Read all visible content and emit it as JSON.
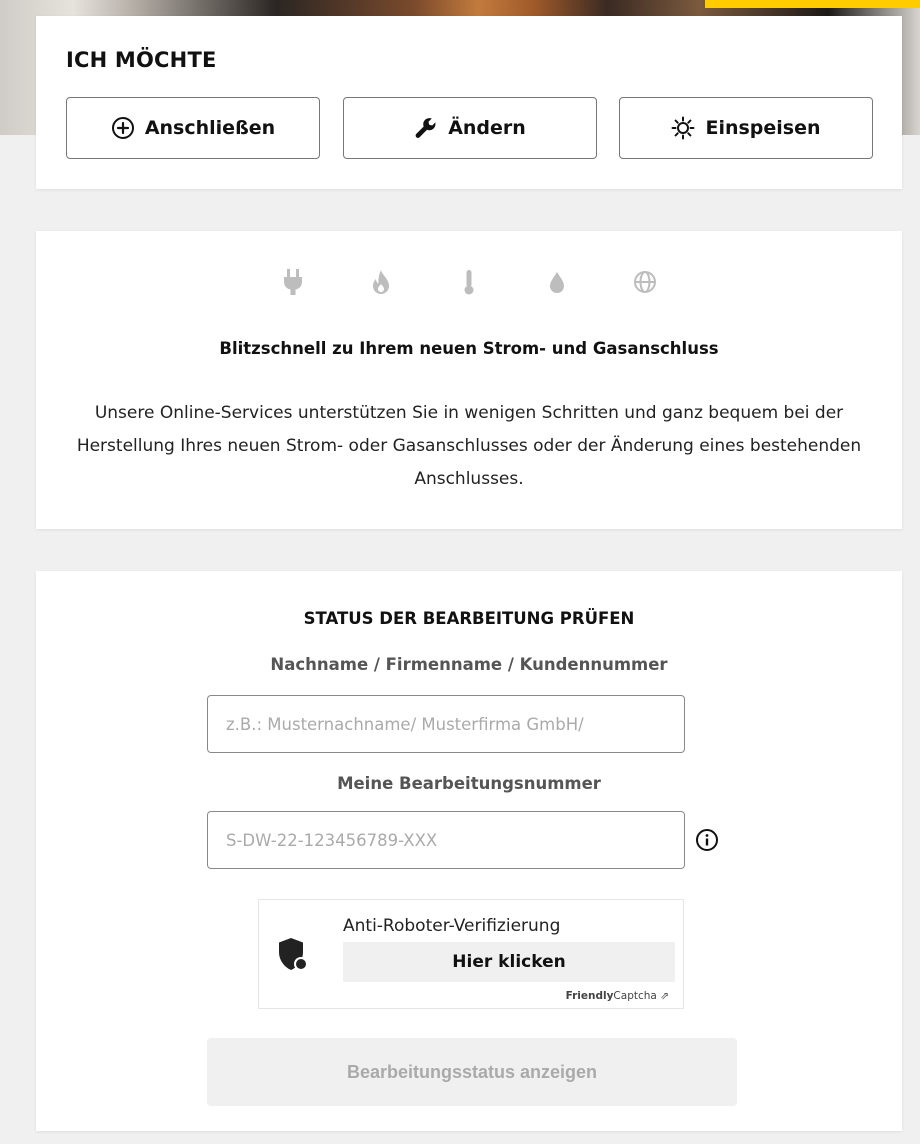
{
  "ich": {
    "title": "ICH MÖCHTE",
    "buttons": [
      {
        "label": "Anschließen",
        "icon": "plus-circle-icon"
      },
      {
        "label": "Ändern",
        "icon": "wrench-icon"
      },
      {
        "label": "Einspeisen",
        "icon": "sun-icon"
      }
    ]
  },
  "info": {
    "icons": [
      "plug-icon",
      "flame-icon",
      "thermometer-icon",
      "water-drop-icon",
      "globe-icon"
    ],
    "headline": "Blitzschnell zu Ihrem neuen Strom- und Gasanschluss",
    "description": "Unsere Online-Services unterstützen Sie in wenigen Schritten und ganz bequem bei der Herstellung Ihres neuen Strom- oder Gasanschlusses oder der Änderung eines bestehenden Anschlusses."
  },
  "status": {
    "title": "STATUS DER BEARBEITUNG PRÜFEN",
    "name_label": "Nachname / Firmenname / Kundennummer",
    "name_placeholder": "z.B.: Musternachname/ Musterfirma GmbH/",
    "number_label": "Meine Bearbeitungsnummer",
    "number_placeholder": "S-DW-22-123456789-XXX",
    "captcha": {
      "text": "Anti-Roboter-Verifizierung",
      "button": "Hier klicken",
      "brand_bold": "Friendly",
      "brand_rest": "Captcha"
    },
    "submit_label": "Bearbeitungsstatus anzeigen"
  },
  "colors": {
    "accent_yellow": "#ffcc00",
    "icon_gray": "#bdbdbd",
    "disabled_text": "#aaaaaa"
  }
}
